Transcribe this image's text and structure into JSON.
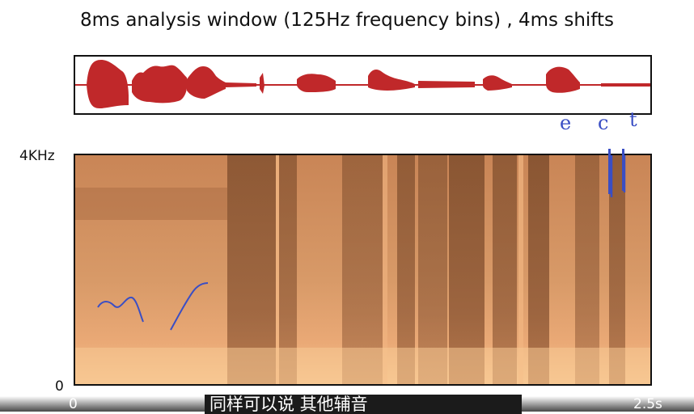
{
  "title": "8ms analysis window (125Hz frequency bins) , 4ms shifts",
  "y_axis": {
    "top": "4KHz",
    "bottom": "0"
  },
  "x_axis": {
    "left": "0",
    "right": "2.5s"
  },
  "annotations": {
    "letters": [
      "e",
      "c",
      "t"
    ]
  },
  "subtitle": "同样可以说 其他辅音",
  "colors": {
    "waveform": "#c0282a",
    "spectrogram_light": "#f0b27a",
    "spectrogram_dark": "#6b4023",
    "ink": "#3a4ec4"
  }
}
